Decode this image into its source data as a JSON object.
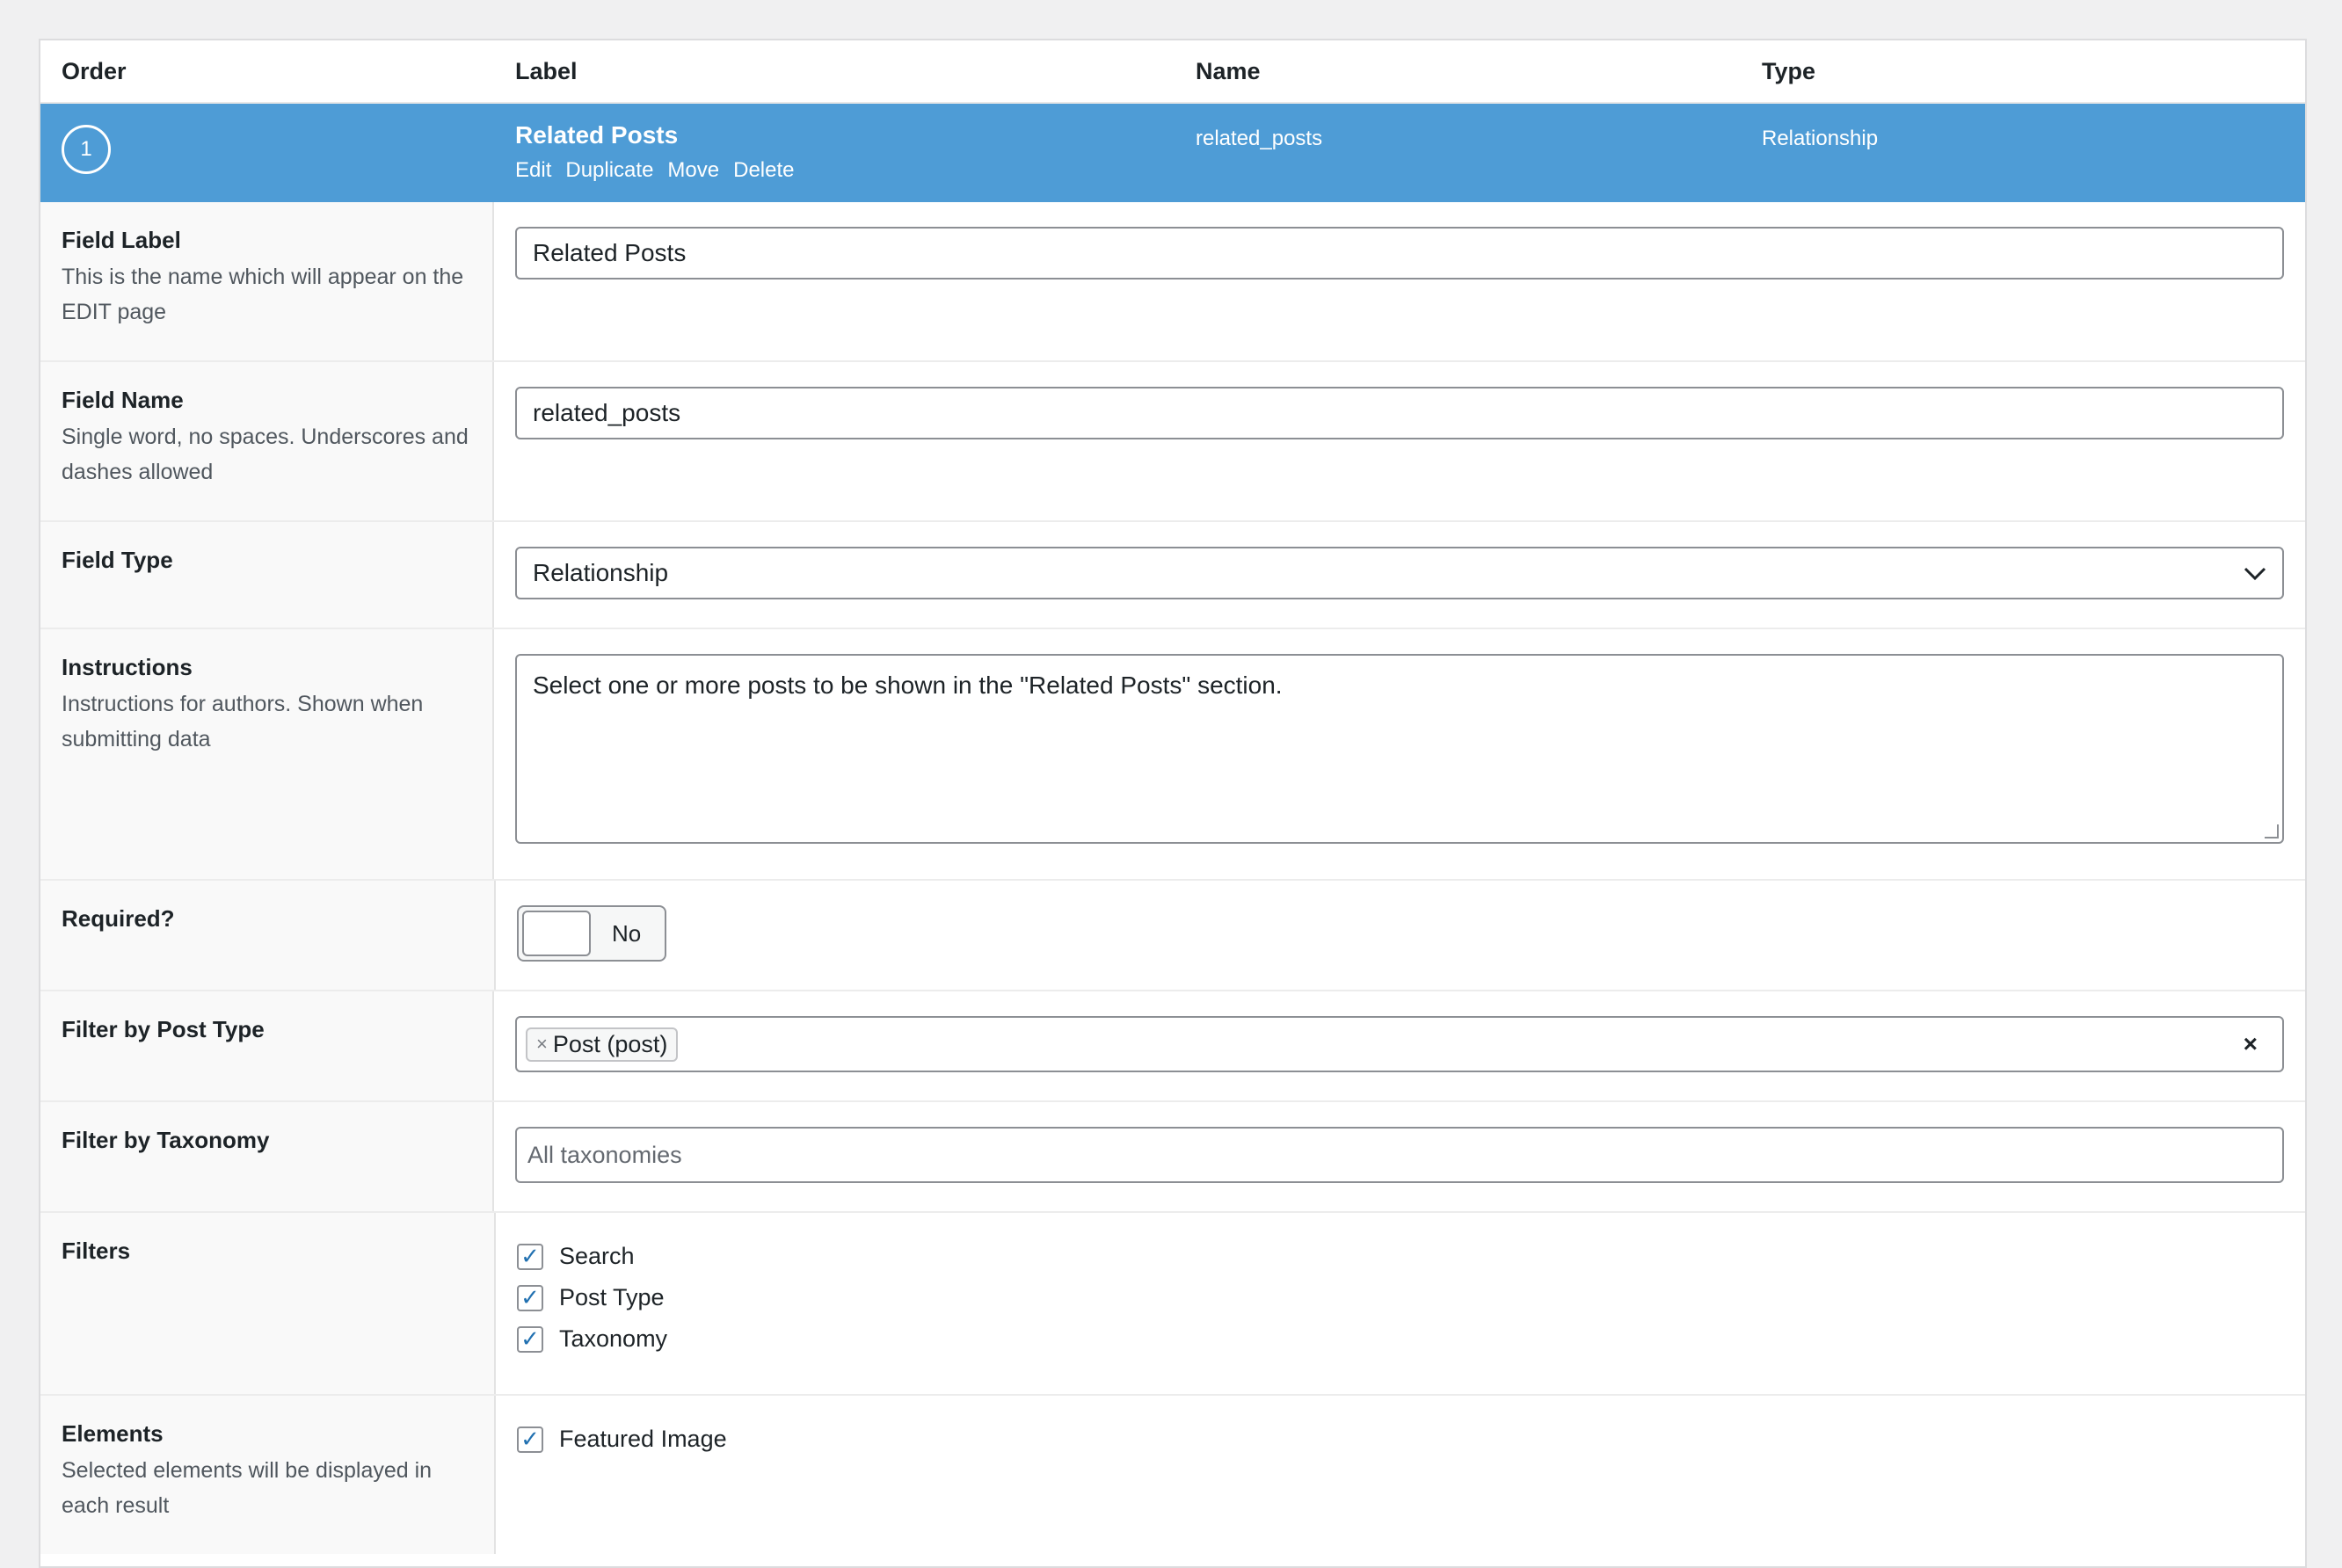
{
  "table_header": {
    "order": "Order",
    "label": "Label",
    "name": "Name",
    "type": "Type"
  },
  "field": {
    "order": "1",
    "label": "Related Posts",
    "actions": [
      "Edit",
      "Duplicate",
      "Move",
      "Delete"
    ],
    "name": "related_posts",
    "type": "Relationship"
  },
  "settings": {
    "field_label": {
      "title": "Field Label",
      "desc": "This is the name which will appear on the EDIT page",
      "value": "Related Posts"
    },
    "field_name": {
      "title": "Field Name",
      "desc": "Single word, no spaces. Underscores and dashes allowed",
      "value": "related_posts"
    },
    "field_type": {
      "title": "Field Type",
      "value": "Relationship"
    },
    "instructions": {
      "title": "Instructions",
      "desc": "Instructions for authors. Shown when submitting data",
      "value": "Select one or more posts to be shown in the \"Related Posts\" section."
    },
    "required": {
      "title": "Required?",
      "state_label": "No"
    },
    "filter_post_type": {
      "title": "Filter by Post Type",
      "chip": "Post (post)",
      "chip_remove": "×",
      "clear": "×"
    },
    "filter_taxonomy": {
      "title": "Filter by Taxonomy",
      "placeholder": "All taxonomies"
    },
    "filters": {
      "title": "Filters",
      "options": [
        "Search",
        "Post Type",
        "Taxonomy"
      ]
    },
    "elements": {
      "title": "Elements",
      "desc": "Selected elements will be displayed in each result",
      "options": [
        "Featured Image"
      ]
    }
  },
  "colors": {
    "accent": "#4e9cd6",
    "check": "#2271b1"
  }
}
